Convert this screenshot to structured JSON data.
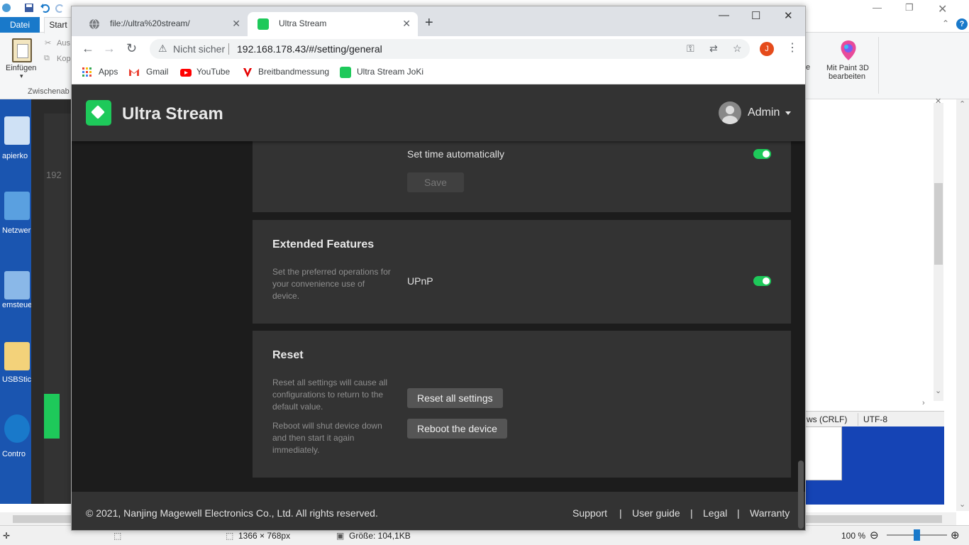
{
  "paint": {
    "file_tab": "Datei",
    "start_tab": "Start",
    "paste_label": "Einfügen",
    "cut_label": "Aus",
    "copy_label": "Kop",
    "clipboard_group": "Zwischenab",
    "paint3d_label_1": "Mit Paint 3D",
    "paint3d_label_2": "bearbeiten",
    "edge_text": "e",
    "status": {
      "dimensions": "1366 × 768px",
      "size": "Größe: 104,1KB",
      "zoom": "100 %",
      "line_ending": "ws (CRLF)",
      "encoding": "UTF-8"
    },
    "desktop_icons": [
      "apierko",
      "Netzwer",
      "emsteue",
      "USBStic",
      "Contro"
    ],
    "strip_texts": [
      "192"
    ]
  },
  "chrome": {
    "tabs": [
      {
        "title": "file://ultra%20stream/"
      },
      {
        "title": "Ultra Stream"
      }
    ],
    "not_secure": "Nicht sicher",
    "url": "192.168.178.43/#/setting/general",
    "profile_initial": "J",
    "bookmarks": [
      "Apps",
      "Gmail",
      "YouTube",
      "Breitbandmessung",
      "Ultra Stream JoKi"
    ]
  },
  "app": {
    "brand": "Ultra Stream",
    "user": "Admin",
    "time_card": {
      "label": "Set time automatically",
      "toggle_on": true,
      "save": "Save"
    },
    "extended": {
      "title": "Extended Features",
      "desc": "Set the preferred operations for your convenience use of device.",
      "upnp_label": "UPnP",
      "upnp_on": true
    },
    "reset": {
      "title": "Reset",
      "reset_desc": "Reset all settings will cause all configurations to return to the default value.",
      "reboot_desc": "Reboot will shut device down and then start it again immediately.",
      "reset_btn": "Reset all settings",
      "reboot_btn": "Reboot the device"
    },
    "footer": {
      "copyright": "© 2021, Nanjing Magewell Electronics Co., Ltd. All rights reserved.",
      "links": [
        "Support",
        "User guide",
        "Legal",
        "Warranty"
      ],
      "separator": "|"
    }
  }
}
